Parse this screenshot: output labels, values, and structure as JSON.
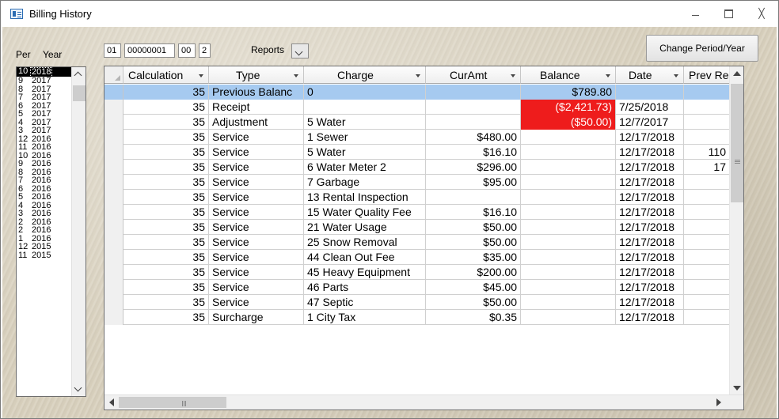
{
  "window": {
    "title": "Billing History"
  },
  "header": {
    "per_label": "Per",
    "year_label": "Year",
    "fields": [
      "01",
      "00000001",
      "00",
      "2"
    ],
    "reports_label": "Reports",
    "change_button": "Change Period/Year"
  },
  "periods": [
    {
      "per": "10",
      "year": "2018",
      "selected": true
    },
    {
      "per": "9",
      "year": "2017"
    },
    {
      "per": "8",
      "year": "2017"
    },
    {
      "per": "7",
      "year": "2017"
    },
    {
      "per": "6",
      "year": "2017"
    },
    {
      "per": "5",
      "year": "2017"
    },
    {
      "per": "4",
      "year": "2017"
    },
    {
      "per": "3",
      "year": "2017"
    },
    {
      "per": "12",
      "year": "2016"
    },
    {
      "per": "11",
      "year": "2016"
    },
    {
      "per": "10",
      "year": "2016"
    },
    {
      "per": "9",
      "year": "2016"
    },
    {
      "per": "8",
      "year": "2016"
    },
    {
      "per": "7",
      "year": "2016"
    },
    {
      "per": "6",
      "year": "2016"
    },
    {
      "per": "5",
      "year": "2016"
    },
    {
      "per": "4",
      "year": "2016"
    },
    {
      "per": "3",
      "year": "2016"
    },
    {
      "per": "2",
      "year": "2016"
    },
    {
      "per": "2",
      "year": "2016"
    },
    {
      "per": "1",
      "year": "2016"
    },
    {
      "per": "12",
      "year": "2015"
    },
    {
      "per": "11",
      "year": "2015"
    }
  ],
  "grid": {
    "columns": [
      "Calculation",
      "Type",
      "Charge",
      "CurAmt",
      "Balance",
      "Date",
      "Prev Re"
    ],
    "rows": [
      {
        "calc": "35",
        "type": "Previous Balanc",
        "charge": "0",
        "curamt": "",
        "balance": "$789.80",
        "date": "",
        "prev": "",
        "highlight": true
      },
      {
        "calc": "35",
        "type": "Receipt",
        "charge": "",
        "curamt": "",
        "balance": "($2,421.73)",
        "date": "7/25/2018",
        "prev": "",
        "balance_red": true
      },
      {
        "calc": "35",
        "type": "Adjustment",
        "charge": "5 Water",
        "curamt": "",
        "balance": "($50.00)",
        "date": "12/7/2017",
        "prev": "",
        "balance_red": true
      },
      {
        "calc": "35",
        "type": "Service",
        "charge": "1 Sewer",
        "curamt": "$480.00",
        "balance": "",
        "date": "12/17/2018",
        "prev": ""
      },
      {
        "calc": "35",
        "type": "Service",
        "charge": "5 Water",
        "curamt": "$16.10",
        "balance": "",
        "date": "12/17/2018",
        "prev": "110"
      },
      {
        "calc": "35",
        "type": "Service",
        "charge": "6 Water Meter 2",
        "curamt": "$296.00",
        "balance": "",
        "date": "12/17/2018",
        "prev": "17"
      },
      {
        "calc": "35",
        "type": "Service",
        "charge": "7 Garbage",
        "curamt": "$95.00",
        "balance": "",
        "date": "12/17/2018",
        "prev": ""
      },
      {
        "calc": "35",
        "type": "Service",
        "charge": "13 Rental Inspection",
        "curamt": "",
        "balance": "",
        "date": "12/17/2018",
        "prev": ""
      },
      {
        "calc": "35",
        "type": "Service",
        "charge": "15 Water Quality Fee",
        "curamt": "$16.10",
        "balance": "",
        "date": "12/17/2018",
        "prev": ""
      },
      {
        "calc": "35",
        "type": "Service",
        "charge": "21 Water Usage",
        "curamt": "$50.00",
        "balance": "",
        "date": "12/17/2018",
        "prev": ""
      },
      {
        "calc": "35",
        "type": "Service",
        "charge": "25 Snow Removal",
        "curamt": "$50.00",
        "balance": "",
        "date": "12/17/2018",
        "prev": ""
      },
      {
        "calc": "35",
        "type": "Service",
        "charge": "44 Clean Out Fee",
        "curamt": "$35.00",
        "balance": "",
        "date": "12/17/2018",
        "prev": ""
      },
      {
        "calc": "35",
        "type": "Service",
        "charge": "45 Heavy Equipment",
        "curamt": "$200.00",
        "balance": "",
        "date": "12/17/2018",
        "prev": ""
      },
      {
        "calc": "35",
        "type": "Service",
        "charge": "46 Parts",
        "curamt": "$45.00",
        "balance": "",
        "date": "12/17/2018",
        "prev": ""
      },
      {
        "calc": "35",
        "type": "Service",
        "charge": "47 Septic",
        "curamt": "$50.00",
        "balance": "",
        "date": "12/17/2018",
        "prev": ""
      },
      {
        "calc": "35",
        "type": "Surcharge",
        "charge": "1 City Tax",
        "curamt": "$0.35",
        "balance": "",
        "date": "12/17/2018",
        "prev": ""
      }
    ]
  },
  "colors": {
    "highlight_row": "#a6caf0",
    "negative_balance": "#ee1c1c"
  }
}
